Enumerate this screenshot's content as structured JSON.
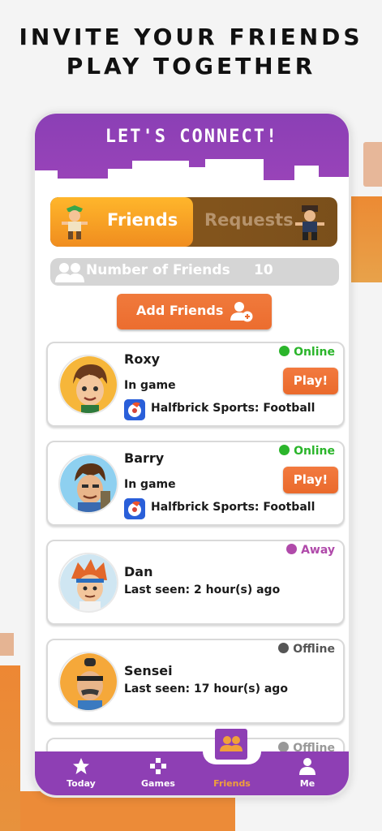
{
  "headline": {
    "line1": "INVITE YOUR FRIENDS",
    "line2": "PLAY TOGETHER"
  },
  "app": {
    "title": "LET'S CONNECT!"
  },
  "tabs": [
    {
      "label": "Friends",
      "active": true
    },
    {
      "label": "Requests",
      "active": false
    }
  ],
  "friends_count": {
    "label": "Number of Friends",
    "value": "10"
  },
  "add_friends": {
    "label": "Add Friends",
    "icon": "add-user-icon"
  },
  "friends": [
    {
      "name": "Roxy",
      "status": "Online",
      "status_color": "#2bb52b",
      "activity": "In game",
      "game": "Halfbrick Sports: Football",
      "action": "Play!"
    },
    {
      "name": "Barry",
      "status": "Online",
      "status_color": "#2bb52b",
      "activity": "In game",
      "game": "Halfbrick Sports: Football",
      "action": "Play!"
    },
    {
      "name": "Dan",
      "status": "Away",
      "status_color": "#b04aaa",
      "last_seen": "Last seen: 2 hour(s) ago"
    },
    {
      "name": "Sensei",
      "status": "Offline",
      "status_color": "#555555",
      "last_seen": "Last seen: 17 hour(s) ago"
    },
    {
      "name": "",
      "status": "Offline",
      "status_color": "#999999"
    }
  ],
  "nav": [
    {
      "label": "Today",
      "icon": "star-icon",
      "active": false
    },
    {
      "label": "Games",
      "icon": "gamepad-icon",
      "active": false
    },
    {
      "label": "Friends",
      "icon": "friends-icon",
      "active": true
    },
    {
      "label": "Me",
      "icon": "person-icon",
      "active": false
    }
  ],
  "colors": {
    "purple": "#8e3fb4",
    "orange": "#ec6d2f",
    "accent": "#f0a03a"
  }
}
